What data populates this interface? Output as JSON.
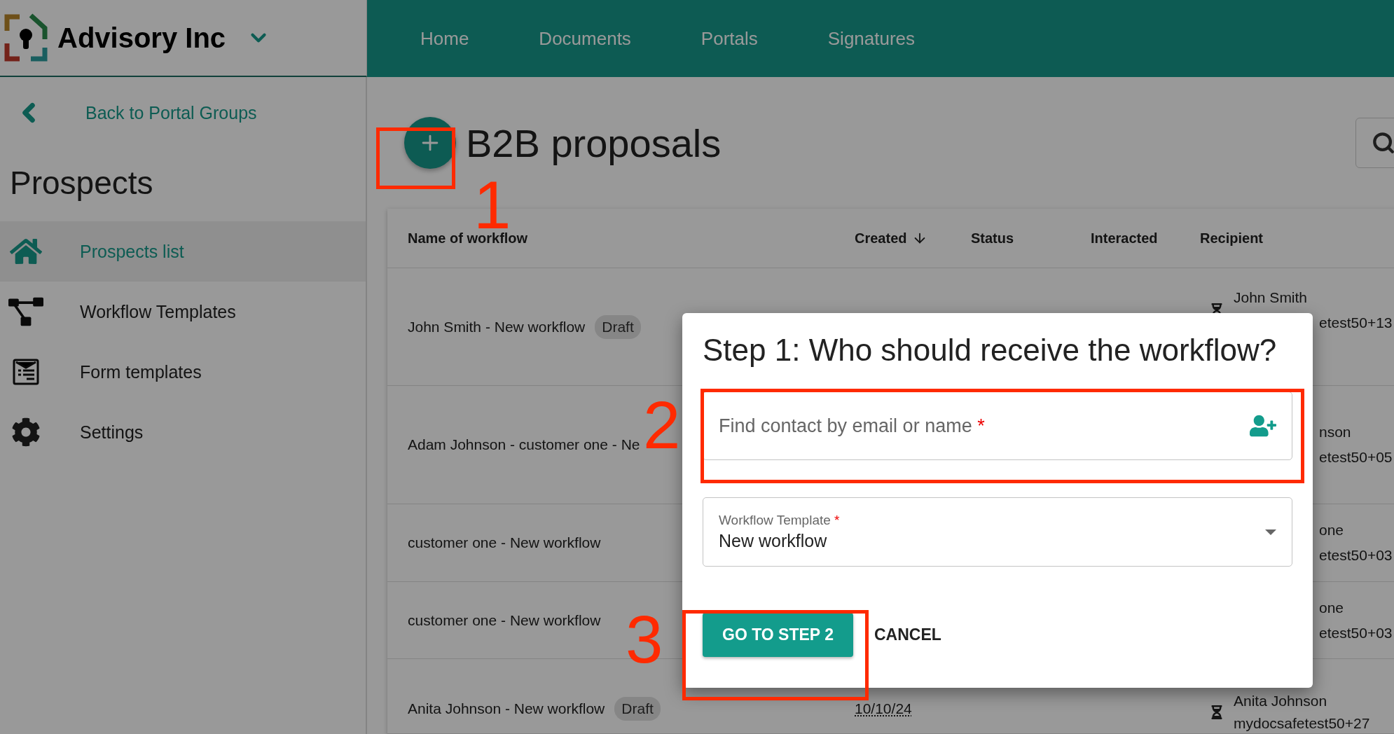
{
  "brand": {
    "name": "Advisory Inc"
  },
  "nav": [
    {
      "label": "Home"
    },
    {
      "label": "Documents"
    },
    {
      "label": "Portals"
    },
    {
      "label": "Signatures"
    }
  ],
  "sidebar": {
    "back_link": "Back to Portal Groups",
    "heading": "Prospects",
    "items": [
      {
        "label": "Prospects list",
        "kind": "home",
        "selected": true
      },
      {
        "label": "Workflow Templates",
        "kind": "workflow",
        "selected": false
      },
      {
        "label": "Form templates",
        "kind": "form",
        "selected": false
      },
      {
        "label": "Settings",
        "kind": "settings",
        "selected": false
      }
    ]
  },
  "page": {
    "title": "B2B proposals"
  },
  "table": {
    "columns": [
      {
        "label": "Name of workflow",
        "sorted": false
      },
      {
        "label": "Created",
        "sorted": true
      },
      {
        "label": "Status",
        "sorted": false
      },
      {
        "label": "Interacted",
        "sorted": false
      },
      {
        "label": "Recipient",
        "sorted": false
      }
    ],
    "rows": [
      {
        "name": "John Smith - New workflow",
        "badge": "Draft",
        "created": "",
        "status_icon": true,
        "recipient_name": "John Smith",
        "recipient_email": "etest50+13"
      },
      {
        "name": "Adam Johnson - customer one - Ne",
        "badge": "",
        "created": "",
        "recipient_name": "nson",
        "recipient_email": "etest50+05"
      },
      {
        "name": "customer one - New workflow",
        "badge": "",
        "created": "",
        "recipient_name": "one",
        "recipient_email": "etest50+03"
      },
      {
        "name": "customer one - New workflow",
        "badge": "",
        "created": "",
        "recipient_name": "one",
        "recipient_email": "etest50+03"
      },
      {
        "name": "Anita Johnson - New workflow",
        "badge": "Draft",
        "created": "10/10/24",
        "status_icon": true,
        "recipient_name": "Anita Johnson",
        "recipient_email": "mydocsafetest50+27"
      }
    ]
  },
  "dialog": {
    "title": "Step 1: Who should receive the workflow?",
    "contact_field": {
      "placeholder": "Find contact by email or name",
      "required_mark": "*"
    },
    "template_field": {
      "label": "Workflow Template",
      "required_mark": "*",
      "value": "New workflow"
    },
    "buttons": [
      {
        "label": "GO TO STEP 2",
        "kind": "primary"
      },
      {
        "label": "CANCEL",
        "kind": "text"
      }
    ]
  },
  "annotations": [
    {
      "label": "1"
    },
    {
      "label": "2"
    },
    {
      "label": "3"
    }
  ]
}
